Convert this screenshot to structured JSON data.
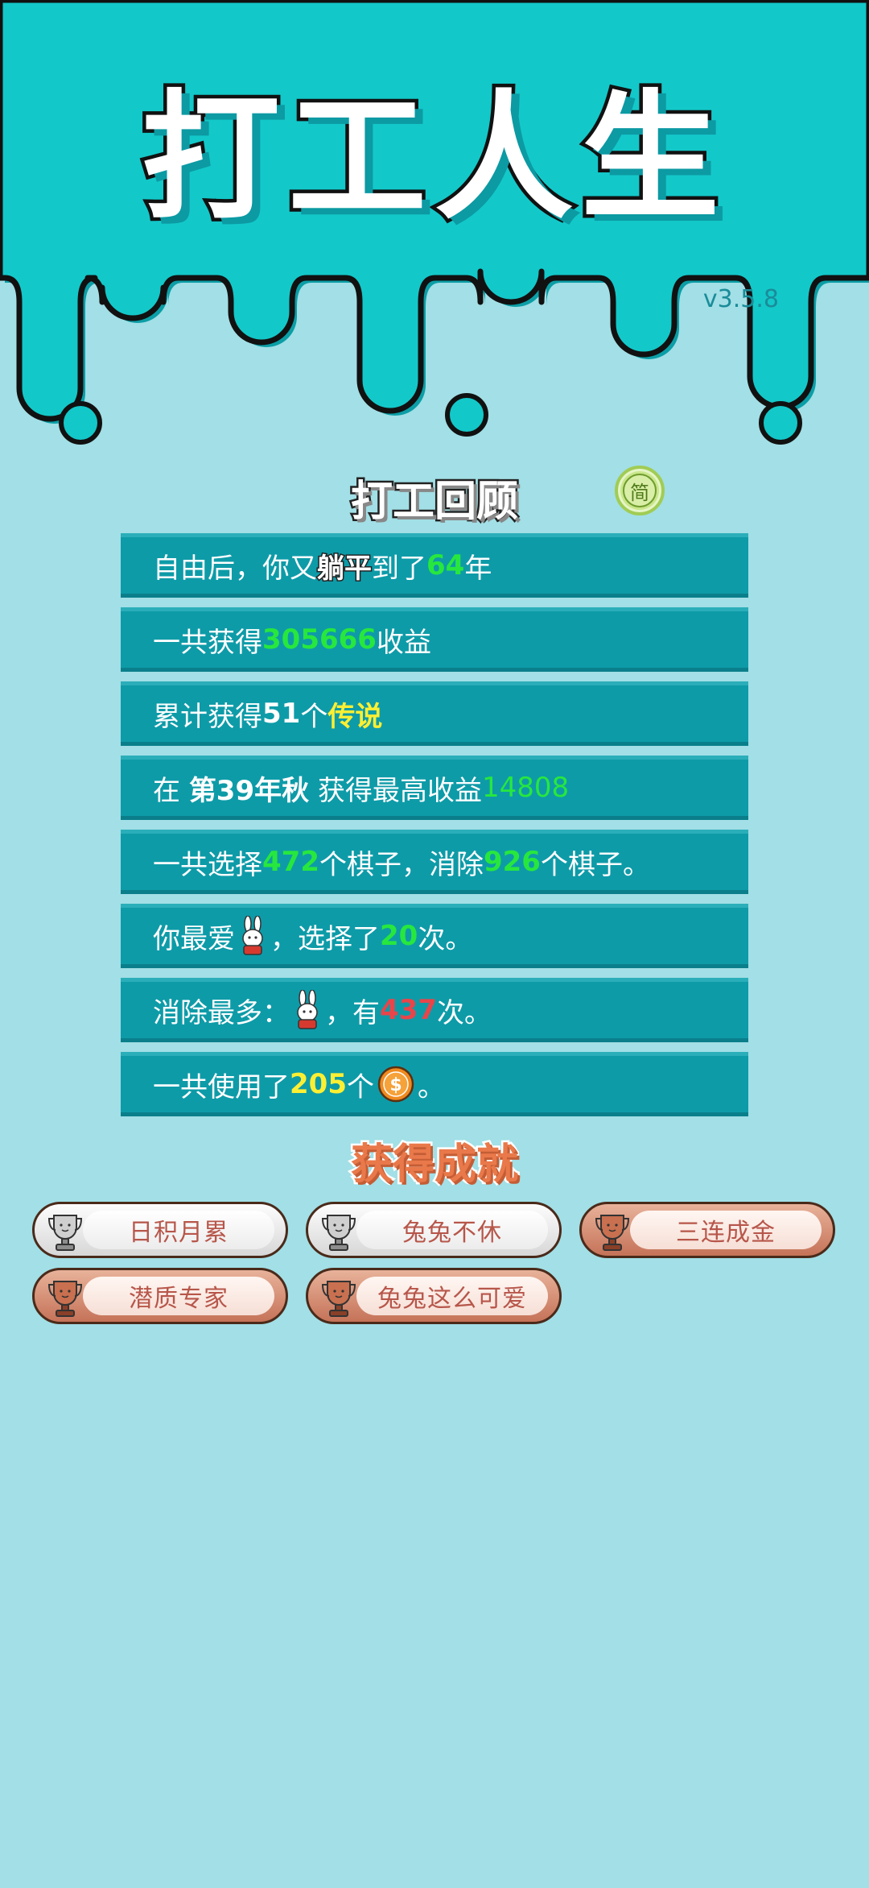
{
  "header": {
    "title": "打工人生",
    "version": "v3.5.8"
  },
  "review": {
    "title": "打工回顾",
    "lang_button": "简"
  },
  "stats": {
    "row1": {
      "pre": "自由后，你又",
      "flat": "躺平",
      "mid": "到了",
      "years": "64",
      "post": "年"
    },
    "row2": {
      "pre": "一共获得",
      "income": "305666",
      "post": "收益"
    },
    "row3": {
      "pre": "累计获得",
      "count": "51",
      "mid": "个",
      "legend": "传说"
    },
    "row4": {
      "pre": "在 ",
      "time": "第39年秋",
      "mid": " 获得最高收益",
      "max": "14808"
    },
    "row5": {
      "pre": "一共选择",
      "chosen": "472",
      "mid": "个棋子，消除",
      "removed": "926",
      "post": "个棋子。"
    },
    "row6": {
      "pre": "你最爱",
      "mid": "，选择了",
      "times": "20",
      "post": "次。"
    },
    "row7": {
      "pre": "消除最多：",
      "mid": "，有",
      "times": "437",
      "post": "次。"
    },
    "row8": {
      "pre": "一共使用了",
      "coins": "205",
      "mid": "个",
      "post": "。"
    }
  },
  "achievements": {
    "title": "获得成就",
    "items": [
      {
        "label": "日积月累",
        "tier": "silver"
      },
      {
        "label": "兔兔不休",
        "tier": "silver"
      },
      {
        "label": "三连成金",
        "tier": "bronze"
      },
      {
        "label": "潜质专家",
        "tier": "bronze"
      },
      {
        "label": "兔兔这么可爱",
        "tier": "bronze"
      }
    ]
  },
  "colors": {
    "top_teal": "#13c8c9",
    "background": "#a2dfe6",
    "row": "#0e9ba8",
    "green": "#27e73e",
    "yellow": "#fcef33",
    "red": "#e8454a"
  }
}
